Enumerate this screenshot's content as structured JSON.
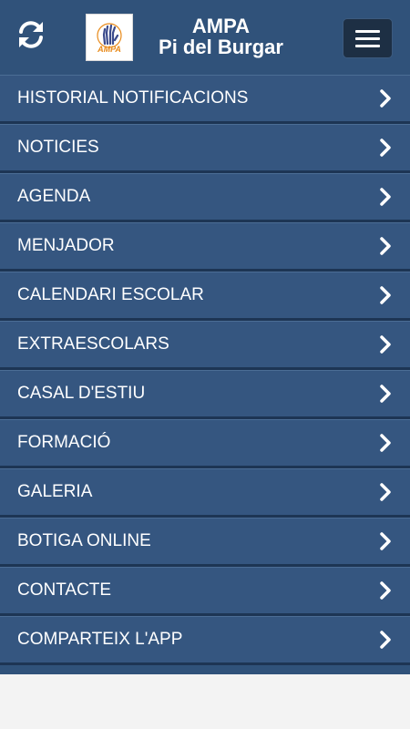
{
  "header": {
    "title_line1": "AMPA",
    "title_line2": "Pi del Burgar",
    "logo_text": "AMPA",
    "refresh_icon": "refresh-icon",
    "menu_icon": "hamburger-icon"
  },
  "menu": {
    "items": [
      {
        "label": "HISTORIAL NOTIFICACIONS"
      },
      {
        "label": "NOTICIES"
      },
      {
        "label": "AGENDA"
      },
      {
        "label": "MENJADOR"
      },
      {
        "label": "CALENDARI ESCOLAR"
      },
      {
        "label": "EXTRAESCOLARS"
      },
      {
        "label": "CASAL D'ESTIU"
      },
      {
        "label": "FORMACIÓ"
      },
      {
        "label": "GALERIA"
      },
      {
        "label": "BOTIGA ONLINE"
      },
      {
        "label": "CONTACTE"
      },
      {
        "label": "COMPARTEIX L'APP"
      }
    ]
  },
  "colors": {
    "header_bg": "#30527a",
    "menu_item_bg": "#355680",
    "menu_button_bg": "#1d2f44",
    "logo_accent": "#e88a1a"
  }
}
